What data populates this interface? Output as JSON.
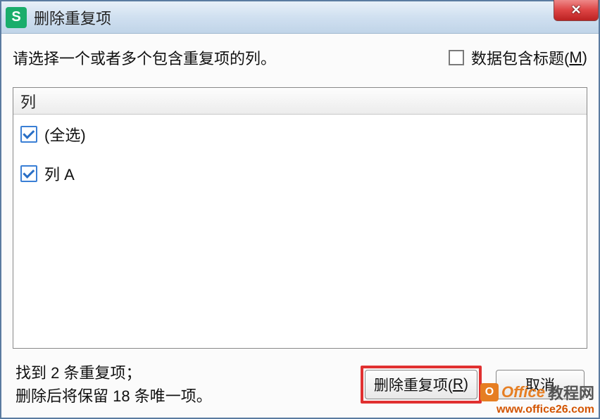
{
  "titlebar": {
    "app_icon_letter": "S",
    "title": "删除重复项",
    "close_label": "✕"
  },
  "instruction": "请选择一个或者多个包含重复项的列。",
  "header_checkbox": {
    "label_prefix": "数据包含标题(",
    "label_hotkey": "M",
    "label_suffix": ")",
    "checked": false
  },
  "list": {
    "header": "列",
    "items": [
      {
        "label": "(全选)",
        "checked": true
      },
      {
        "label": "列 A",
        "checked": true
      }
    ]
  },
  "status": {
    "line1": "找到 2 条重复项；",
    "line2": "删除后将保留 18 条唯一项。"
  },
  "buttons": {
    "remove_prefix": "删除重复项(",
    "remove_hotkey": "R",
    "remove_suffix": ")",
    "cancel": "取消"
  },
  "watermark": {
    "icon_letter": "O",
    "brand": "Office",
    "brand_cn": "教程网",
    "url": "www.office26.com"
  }
}
